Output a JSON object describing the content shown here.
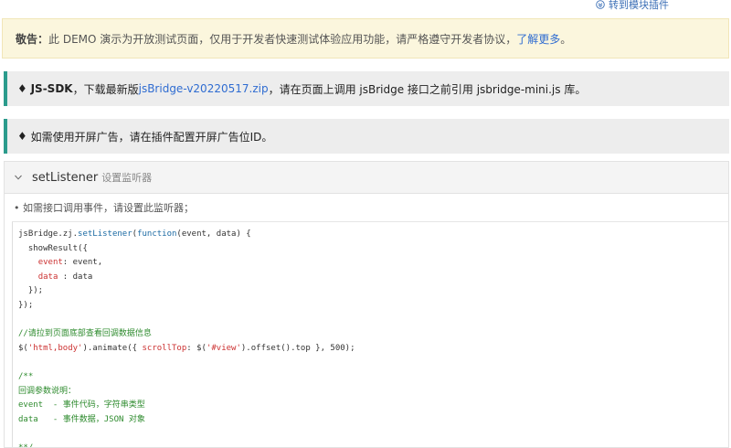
{
  "top": {
    "switch_label": "转到模块插件"
  },
  "notice": {
    "lead": "敬告：",
    "text": "此 DEMO 演示为开放测试页面，仅用于开发者快速测试体验应用功能，请严格遵守开发者协议，",
    "link": "了解更多",
    "tail": "。"
  },
  "tips": [
    {
      "bullet": "♦",
      "bold": "JS-SDK",
      "pre": "，下载最新版 ",
      "link": "jsBridge-v20220517.zip",
      "post": "，请在页面上调用 jsBridge 接口之前引用 jsbridge-mini.js 库。"
    },
    {
      "bullet": "♦",
      "text": "如需使用开屏广告，请在插件配置开屏广告位ID。"
    }
  ],
  "panel": {
    "title": "setListener",
    "subtitle": "设置监听器",
    "description": "• 如需接口调用事件，请设置此监听器；"
  },
  "code": {
    "l1a": "jsBridge.zj.",
    "l1b": "setListener",
    "l1c": "(",
    "l1d": "function",
    "l1e": "(event, data) {",
    "l2": "  showResult({",
    "l3a": "    ",
    "l3b": "event",
    "l3c": ": event,",
    "l4a": "    ",
    "l4b": "data",
    "l4c": " : data",
    "l5": "  });",
    "l6": "});",
    "l8": "//请拉到页面底部查看回调数据信息",
    "l9a": "$(",
    "l9b": "'html,body'",
    "l9c": ").animate({ ",
    "l9d": "scrollTop",
    "l9e": ": $(",
    "l9f": "'#view'",
    "l9g": ").offset().top }, 500);",
    "l11": "/**",
    "l12": "回调参数说明：",
    "l13": "event  - 事件代码，字符串类型",
    "l14": "data   - 事件数据，JSON 对象",
    "l16": "**/"
  }
}
